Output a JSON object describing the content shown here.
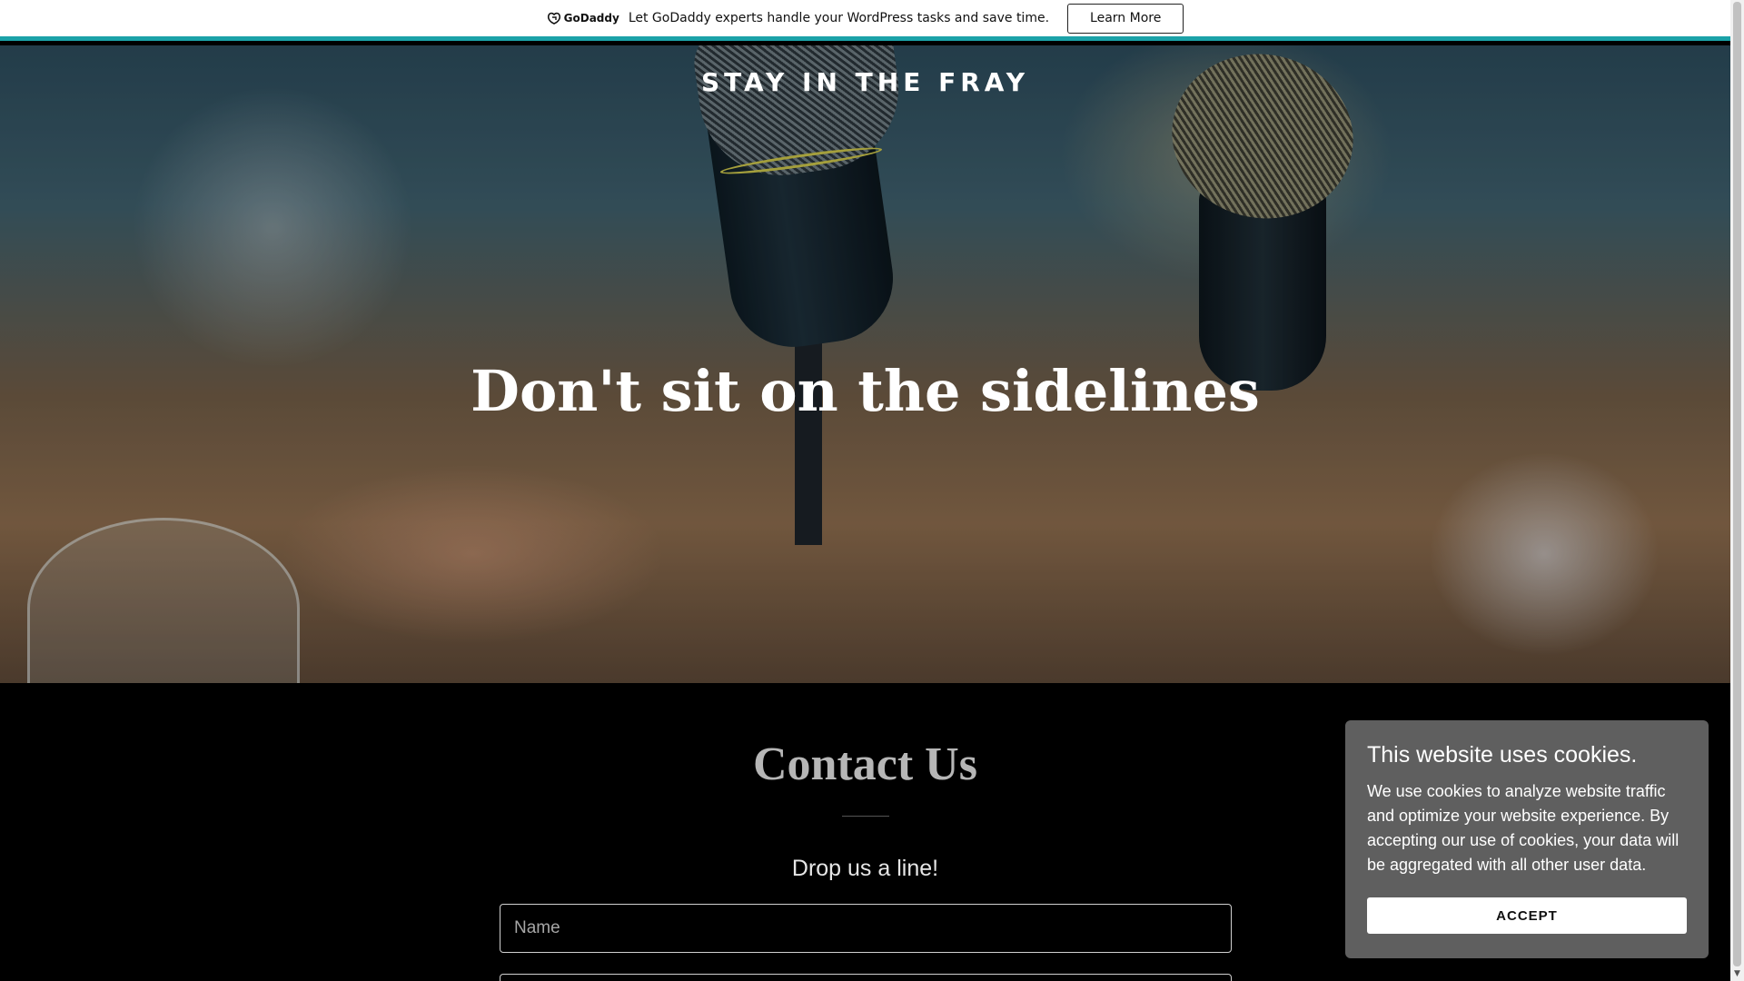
{
  "promo": {
    "logo_text": "GoDaddy",
    "message": "Let GoDaddy experts handle your WordPress tasks and save time.",
    "button_label": "Learn More",
    "accent_color": "#1ba2a8"
  },
  "hero": {
    "site_title": "STAY IN THE FRAY",
    "headline": "Don't sit on the sidelines"
  },
  "contact": {
    "title": "Contact Us",
    "subtitle": "Drop us a line!",
    "name_placeholder": "Name"
  },
  "cookie": {
    "title": "This website uses cookies.",
    "text": "We use cookies to analyze website traffic and optimize your website experience. By accepting our use of cookies, your data will be aggregated with all other user data.",
    "accept_label": "ACCEPT",
    "panel_color": "#5f5f5f"
  },
  "icons": {
    "promo_logo": "godaddy-logo-icon",
    "scroll_down": "chevron-down-icon"
  }
}
